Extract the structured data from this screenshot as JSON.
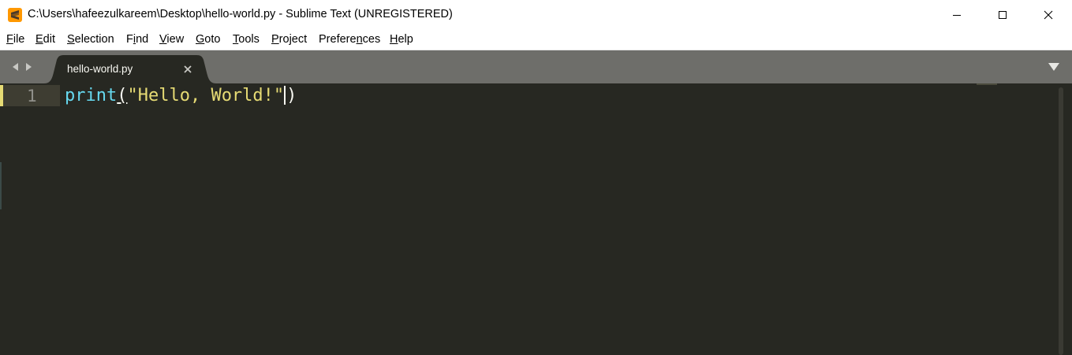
{
  "window": {
    "title": "C:\\Users\\hafeezulkareem\\Desktop\\hello-world.py - Sublime Text (UNREGISTERED)",
    "app_icon": "sublime-text-icon",
    "controls": [
      "minimize-icon",
      "maximize-icon",
      "close-icon"
    ]
  },
  "menu": {
    "items": [
      {
        "label_pre": "",
        "label_ul": "F",
        "label_post": "ile"
      },
      {
        "label_pre": "",
        "label_ul": "E",
        "label_post": "dit"
      },
      {
        "label_pre": "",
        "label_ul": "S",
        "label_post": "election"
      },
      {
        "label_pre": "F",
        "label_ul": "i",
        "label_post": "nd"
      },
      {
        "label_pre": "",
        "label_ul": "V",
        "label_post": "iew"
      },
      {
        "label_pre": "",
        "label_ul": "G",
        "label_post": "oto"
      },
      {
        "label_pre": "",
        "label_ul": "T",
        "label_post": "ools"
      },
      {
        "label_pre": "",
        "label_ul": "P",
        "label_post": "roject"
      },
      {
        "label_pre": "Prefere",
        "label_ul": "n",
        "label_post": "ces"
      },
      {
        "label_pre": "",
        "label_ul": "H",
        "label_post": "elp"
      }
    ]
  },
  "tabs": {
    "active": {
      "label": "hello-world.py"
    }
  },
  "editor": {
    "line_number": "1",
    "code": {
      "func": "print",
      "open_paren": "(",
      "string": "\"Hello, World!\"",
      "close_paren": ")"
    }
  },
  "colors": {
    "editor_bg": "#272822",
    "tabbar_bg": "#6e6e6a",
    "func": "#66d9ef",
    "string": "#e6db74",
    "line_highlight": "#3e3d32"
  }
}
